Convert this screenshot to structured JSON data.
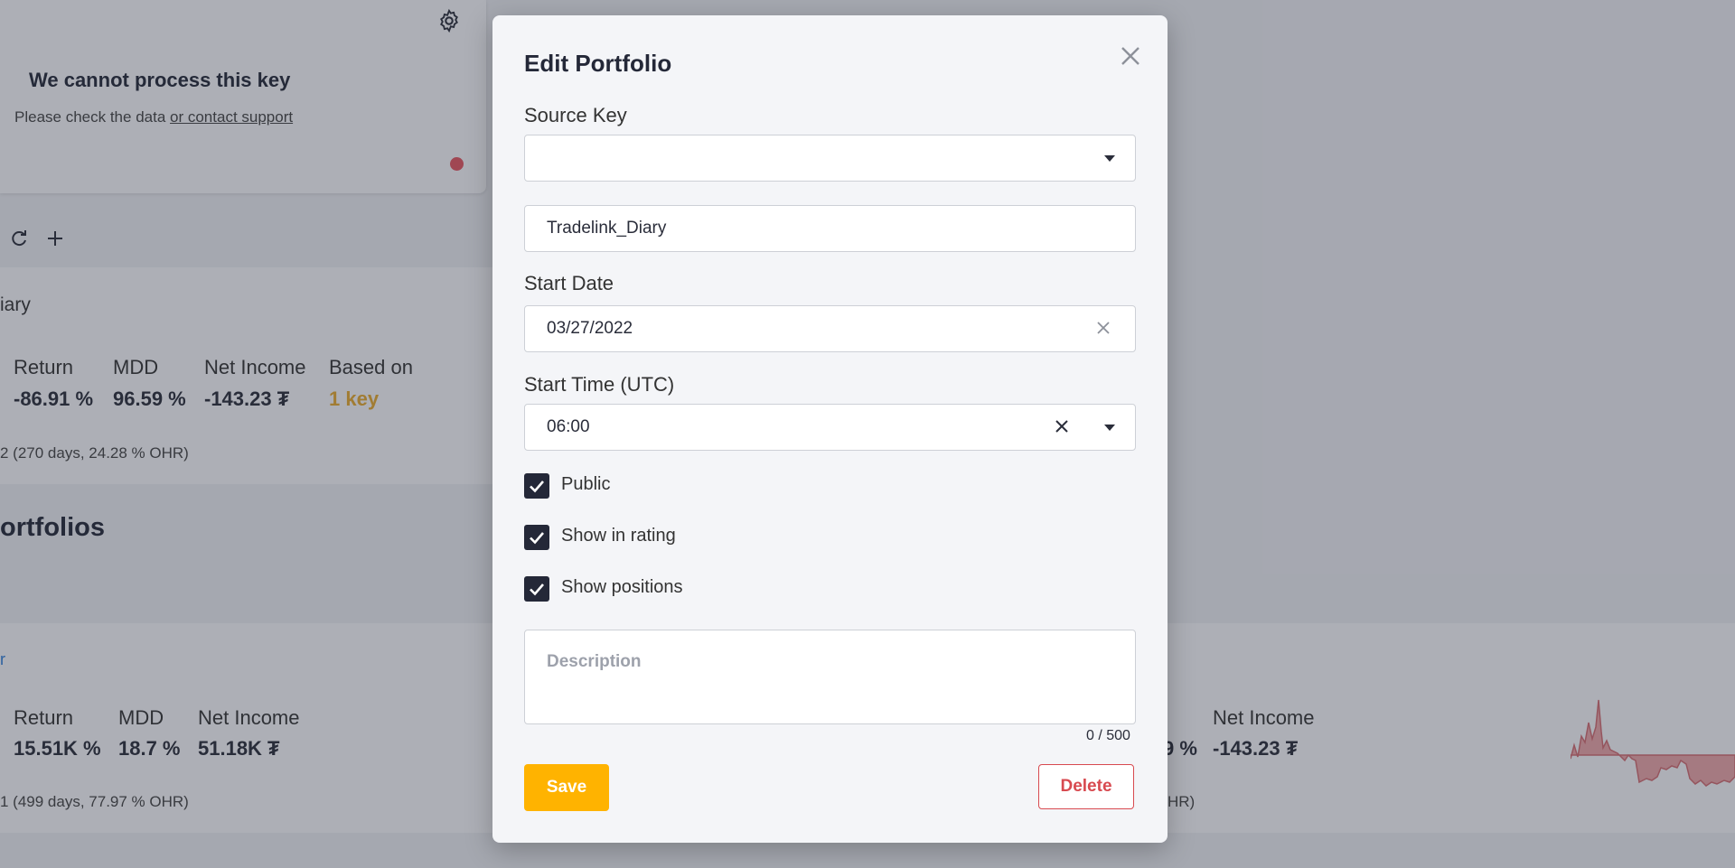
{
  "background": {
    "warning": {
      "title": "We cannot process this key",
      "prefix": "Please check the data ",
      "link": "or contact support"
    },
    "portfolio": {
      "name_fragment": "iary",
      "metrics": [
        {
          "label": "Return",
          "value": "-86.91 %"
        },
        {
          "label": "MDD",
          "value": "96.59 %"
        },
        {
          "label": "Net Income",
          "value": "-143.23 ₮"
        },
        {
          "label": "Based on",
          "value": "1 key"
        }
      ],
      "footer": "2 (270 days, 24.28 % OHR)"
    },
    "section_title": "ortfolios",
    "bottom_left": {
      "link_fragment": "r",
      "metrics": [
        {
          "label": "Return",
          "value": "15.51K %"
        },
        {
          "label": "MDD",
          "value": "18.7 %"
        },
        {
          "label": "Net Income",
          "value": "51.18K ₮"
        }
      ],
      "footer": "1 (499 days, 77.97 % OHR)"
    },
    "bottom_right": {
      "value_fragment": "9 %",
      "metric": {
        "label": "Net Income",
        "value": "-143.23 ₮"
      },
      "footer_fragment": "HR)"
    }
  },
  "modal": {
    "title": "Edit Portfolio",
    "source_key": {
      "label": "Source Key",
      "value": ""
    },
    "name_value": "Tradelink_Diary",
    "start_date": {
      "label": "Start Date",
      "value": "03/27/2022"
    },
    "start_time": {
      "label": "Start Time (UTC)",
      "value": "06:00"
    },
    "checkboxes": [
      {
        "label": "Public",
        "checked": true
      },
      {
        "label": "Show in rating",
        "checked": true
      },
      {
        "label": "Show positions",
        "checked": true
      }
    ],
    "description": {
      "placeholder": "Description",
      "counter": "0 / 500"
    },
    "save_label": "Save",
    "delete_label": "Delete"
  },
  "colors": {
    "accent_yellow": "#ffb300",
    "danger_red": "#d84a50",
    "key_orange": "#e2a72e",
    "checkbox_dark": "#242838"
  }
}
